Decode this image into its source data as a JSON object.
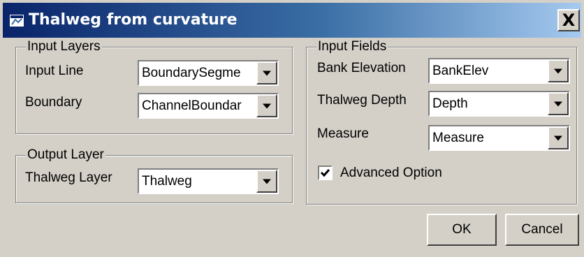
{
  "window": {
    "title": "Thalweg from curvature",
    "close_label": "X"
  },
  "input_layers": {
    "legend": "Input Layers",
    "input_line": {
      "label": "Input Line",
      "value": "BoundarySegme"
    },
    "boundary": {
      "label": "Boundary",
      "value": "ChannelBoundar"
    }
  },
  "output_layer": {
    "legend": "Output Layer",
    "thalweg_layer": {
      "label": "Thalweg Layer",
      "value": "Thalweg"
    }
  },
  "input_fields": {
    "legend": "Input Fields",
    "bank_elevation": {
      "label": "Bank Elevation",
      "value": "BankElev"
    },
    "thalweg_depth": {
      "label": "Thalweg Depth",
      "value": "Depth"
    },
    "measure": {
      "label": "Measure",
      "value": "Measure"
    },
    "advanced_option": {
      "label": "Advanced Option",
      "checked": true
    }
  },
  "buttons": {
    "ok": "OK",
    "cancel": "Cancel"
  },
  "icons": {
    "app": "map-icon",
    "close": "close-icon",
    "dropdown": "chevron-down-icon",
    "check": "checkmark-icon"
  },
  "colors": {
    "title_start": "#0a246a",
    "title_end": "#a6caf0",
    "face": "#d4d0c8"
  }
}
